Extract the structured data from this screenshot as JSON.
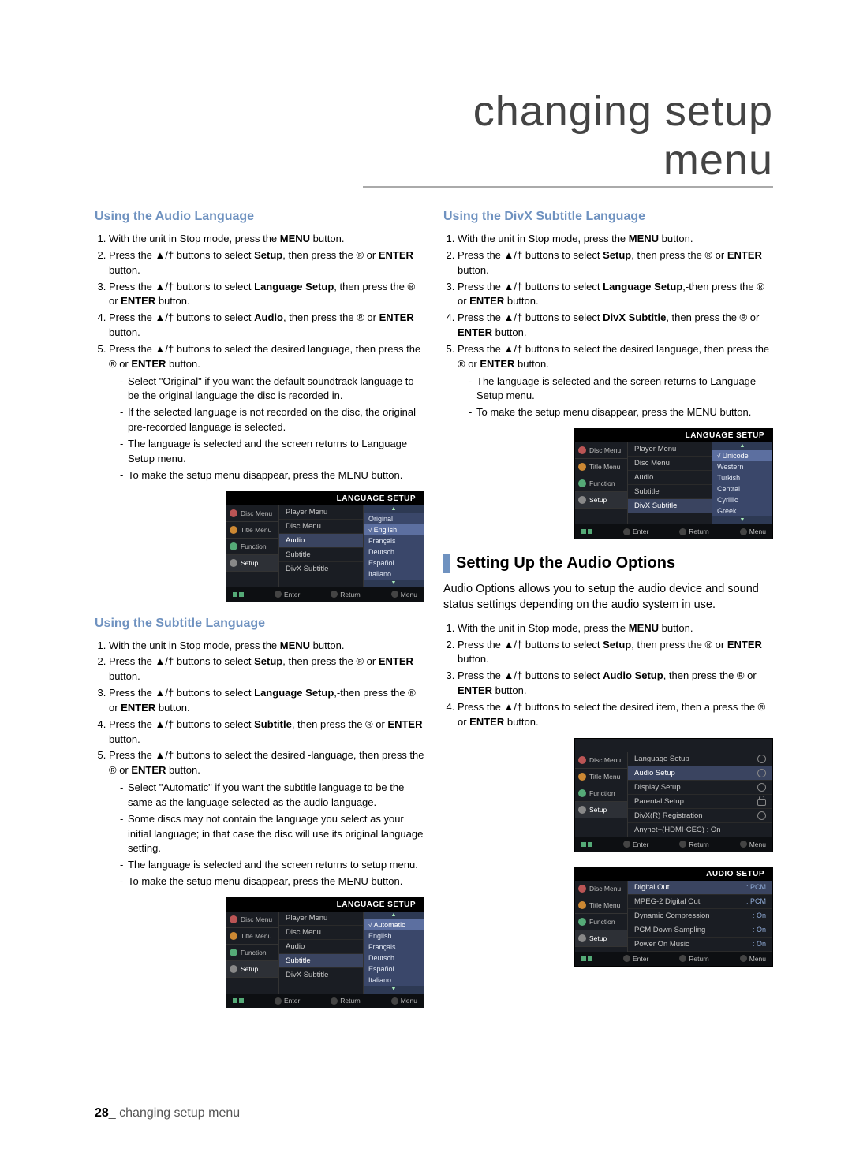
{
  "page": {
    "chapter_title": "changing setup menu",
    "footer_number": "28",
    "footer_text": "changing setup menu"
  },
  "glyph": {
    "up": "▲",
    "down": "†",
    "play": "®"
  },
  "sec_audio_lang": {
    "heading": "Using the Audio Language",
    "steps": [
      {
        "pre": "With the unit in Stop mode, press the ",
        "b": "MENU",
        "post": " button."
      },
      {
        "pre": "Press the ▲/† buttons to select ",
        "b": "Setup",
        "post": ", then press the ® or ",
        "b2": "ENTER",
        "post2": " button."
      },
      {
        "pre": "Press the ▲/† buttons to select ",
        "b": "Language Setup",
        "post": ", then press the ® or ",
        "b2": "ENTER",
        "post2": " button."
      },
      {
        "pre": "Press the ▲/† buttons to select ",
        "b": "Audio",
        "post": ", then press the ® or ",
        "b2": "ENTER",
        "post2": " button."
      },
      {
        "pre": "Press the ▲/† buttons to select the desired language, then press the ® or ",
        "b": "ENTER",
        "post": " button.",
        "dash": [
          "Select \"Original\" if you want the default soundtrack language to be the original language the disc is recorded in.",
          "If the selected language is not recorded on the disc, the original pre-recorded language is selected.",
          "The language is selected and the screen returns to Language Setup menu.",
          "To make the setup menu disappear, press the MENU button."
        ]
      }
    ]
  },
  "sec_sub_lang": {
    "heading": "Using the Subtitle Language",
    "steps": [
      {
        "pre": "With the unit in Stop mode, press the ",
        "b": "MENU",
        "post": " button."
      },
      {
        "pre": "Press the ▲/† buttons to select ",
        "b": "Setup",
        "post": ", then press the ® or ",
        "b2": "ENTER",
        "post2": " button."
      },
      {
        "pre": "Press the ▲/† buttons to select ",
        "b": "Language Setup",
        "post": ",-then press the ® or ",
        "b2": "ENTER",
        "post2": " button."
      },
      {
        "pre": "Press the ▲/† buttons to select ",
        "b": "Subtitle",
        "post": ", then press the ® or ",
        "b2": "ENTER",
        "post2": " button."
      },
      {
        "pre": "Press the ▲/† buttons to select the desired -language, then press the ® or ",
        "b": "ENTER",
        "post": " button.",
        "dash": [
          "Select \"Automatic\" if you want the subtitle language to be the same as the language selected as the audio language.",
          "Some discs may not contain the language you select as your initial language; in that case the disc will use its original language setting.",
          "The language is selected and the screen returns to setup menu.",
          "To make the setup menu disappear, press the MENU button."
        ]
      }
    ]
  },
  "sec_divx": {
    "heading": "Using the DivX Subtitle Language",
    "steps": [
      {
        "pre": "With the unit in Stop mode, press the ",
        "b": "MENU",
        "post": " button."
      },
      {
        "pre": "Press the ▲/† buttons to select ",
        "b": "Setup",
        "post": ", then press the ® or ",
        "b2": "ENTER",
        "post2": " button."
      },
      {
        "pre": "Press the ▲/† buttons to select ",
        "b": "Language Setup",
        "post": ",-then press the ® or ",
        "b2": "ENTER",
        "post2": " button."
      },
      {
        "pre": "Press the ▲/† buttons to select ",
        "b": "DivX Subtitle",
        "post": ", then press the ® or ",
        "b2": "ENTER",
        "post2": " button."
      },
      {
        "pre": "Press the ▲/† buttons to select the desired language, then press the ® or ",
        "b": "ENTER",
        "post": " button.",
        "dash": [
          "The language is selected and the screen returns to Language Setup menu.",
          "To make the setup menu disappear, press the MENU button."
        ]
      }
    ]
  },
  "sec_audio_opt": {
    "heading": "Setting Up the Audio Options",
    "intro": "Audio Options allows you to setup the audio device and sound status settings depending on the audio system in use.",
    "steps": [
      {
        "pre": "With the unit in Stop mode, press the ",
        "b": "MENU",
        "post": " button."
      },
      {
        "pre": "Press the ▲/† buttons to select ",
        "b": "Setup",
        "post": ", then press the ® or ",
        "b2": "ENTER",
        "post2": " button."
      },
      {
        "pre": "Press the ▲/† buttons to select ",
        "b": "Audio Setup",
        "post": ", then press the ® or ",
        "b2": "ENTER",
        "post2": " button."
      },
      {
        "pre": "Press the ▲/† buttons to select the desired item, then a press the ® or ",
        "b": "ENTER",
        "post": " button."
      }
    ]
  },
  "osd": {
    "tabs": [
      "Disc Menu",
      "Title Menu",
      "Function",
      "Setup"
    ],
    "title_lang": "LANGUAGE SETUP",
    "title_audio": "AUDIO SETUP",
    "menu_items": [
      "Player Menu",
      "Disc Menu",
      "Audio",
      "Subtitle",
      "DivX Subtitle"
    ],
    "opts_audio": [
      "Original",
      "English",
      "Français",
      "Deutsch",
      "Español",
      "Italiano"
    ],
    "opts_sub": [
      "Automatic",
      "English",
      "Français",
      "Deutsch",
      "Español",
      "Italiano"
    ],
    "opts_divx": [
      "Unicode",
      "Western",
      "Turkish",
      "Central",
      "Cyrillic",
      "Greek"
    ],
    "setup_root": [
      {
        "l": "Language Setup",
        "ic": "gear"
      },
      {
        "l": "Audio Setup",
        "ic": "gear"
      },
      {
        "l": "Display Setup",
        "ic": "gear"
      },
      {
        "l": "Parental Setup :",
        "ic": "lock"
      },
      {
        "l": "DivX(R) Registration",
        "ic": "gear"
      },
      {
        "l": "Anynet+(HDMI-CEC) : On",
        "ic": ""
      }
    ],
    "audio_setup": [
      {
        "l": "Digital Out",
        "v": ": PCM"
      },
      {
        "l": "MPEG-2 Digital Out",
        "v": ": PCM"
      },
      {
        "l": "Dynamic Compression",
        "v": ": On"
      },
      {
        "l": "PCM Down Sampling",
        "v": ": On"
      },
      {
        "l": "Power On Music",
        "v": ": On"
      }
    ],
    "foot": {
      "enter": "Enter",
      "return": "Return",
      "menu": "Menu"
    }
  }
}
